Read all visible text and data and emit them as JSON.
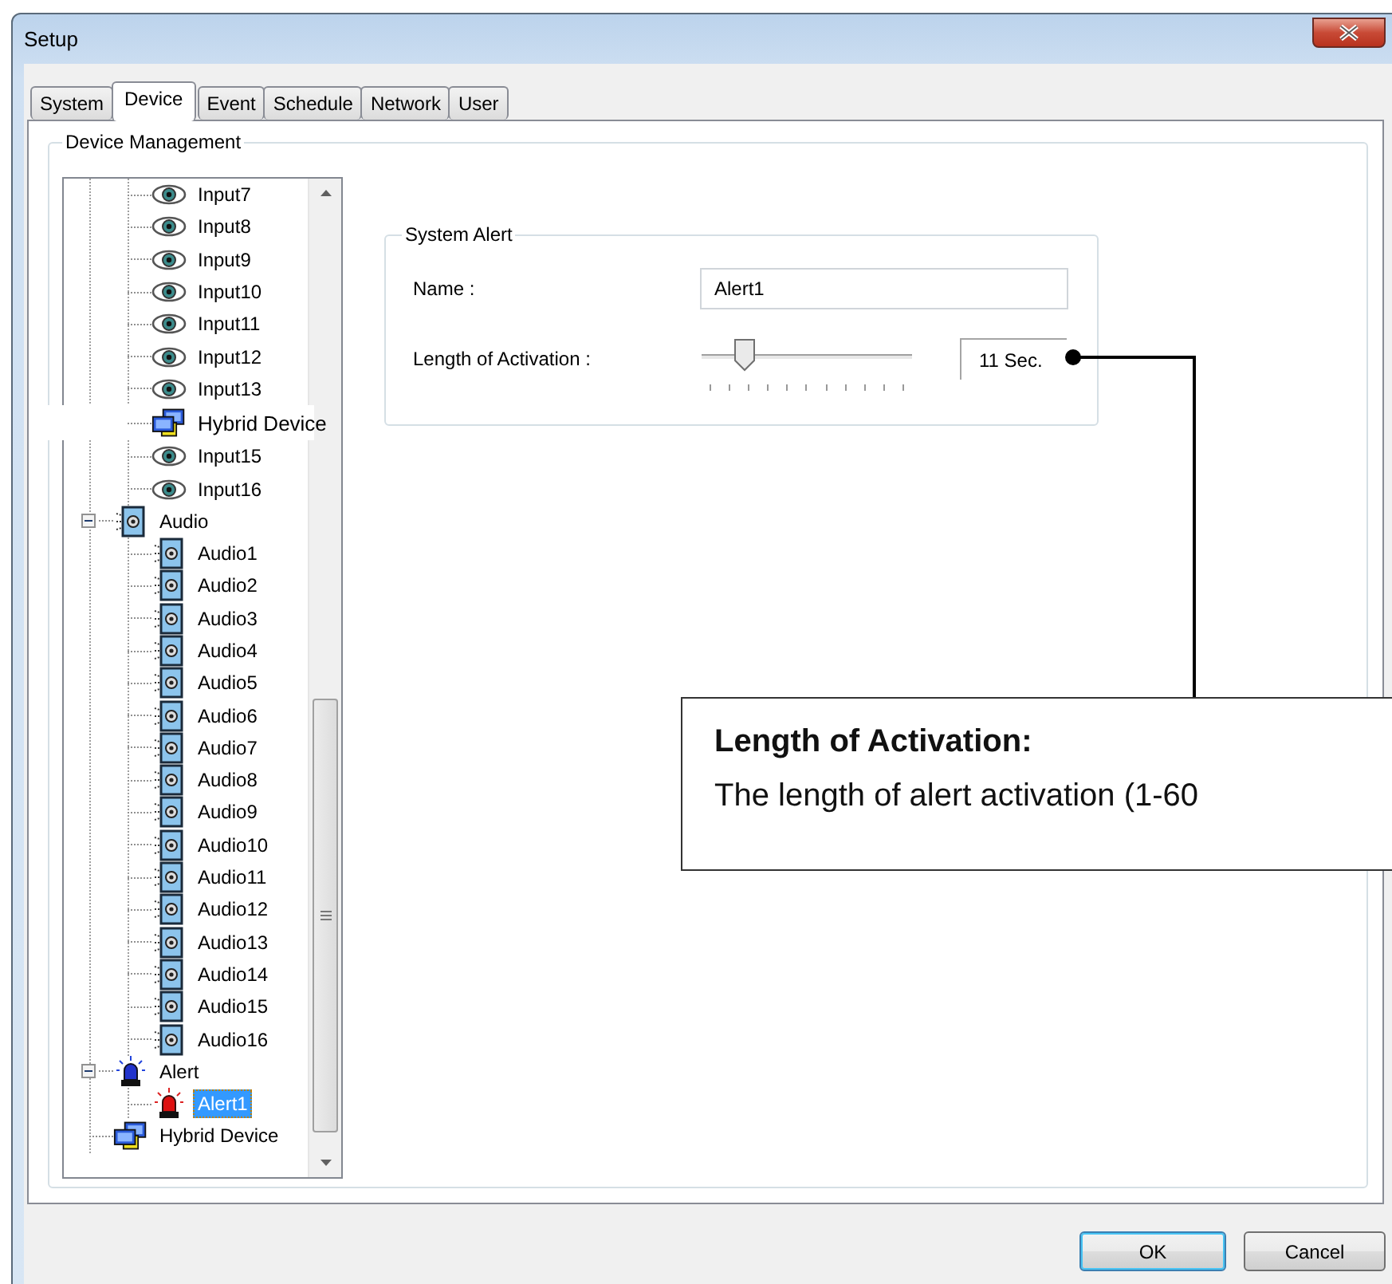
{
  "window": {
    "title": "Setup"
  },
  "tabs": [
    {
      "label": "System",
      "selected": false
    },
    {
      "label": "Device",
      "selected": true
    },
    {
      "label": "Event",
      "selected": false
    },
    {
      "label": "Schedule",
      "selected": false
    },
    {
      "label": "Network",
      "selected": false
    },
    {
      "label": "User",
      "selected": false
    }
  ],
  "group_title": "Device Management",
  "tree": [
    {
      "children": [
        {
          "label": "Input7",
          "kind": "camera",
          "selected": false
        },
        {
          "label": "Input8",
          "kind": "camera",
          "selected": false
        },
        {
          "label": "Input9",
          "kind": "camera",
          "selected": false
        },
        {
          "label": "Input10",
          "kind": "camera",
          "selected": false
        },
        {
          "label": "Input11",
          "kind": "camera",
          "selected": false
        },
        {
          "label": "Input12",
          "kind": "camera",
          "selected": false
        },
        {
          "label": "Input13",
          "kind": "camera",
          "selected": false
        },
        {
          "label": "Hybrid Device",
          "kind": "pasted_label",
          "selected": false
        },
        {
          "label": "Input15",
          "kind": "camera",
          "selected": false
        },
        {
          "label": "Input16",
          "kind": "camera",
          "selected": false
        }
      ]
    },
    {
      "label": "Audio",
      "kind": "audio_group",
      "expanded": true,
      "selected": false,
      "children": [
        {
          "label": "Audio1",
          "kind": "audio",
          "selected": false
        },
        {
          "label": "Audio2",
          "kind": "audio",
          "selected": false
        },
        {
          "label": "Audio3",
          "kind": "audio",
          "selected": false
        },
        {
          "label": "Audio4",
          "kind": "audio",
          "selected": false
        },
        {
          "label": "Audio5",
          "kind": "audio",
          "selected": false
        },
        {
          "label": "Audio6",
          "kind": "audio",
          "selected": false
        },
        {
          "label": "Audio7",
          "kind": "audio",
          "selected": false
        },
        {
          "label": "Audio8",
          "kind": "audio",
          "selected": false
        },
        {
          "label": "Audio9",
          "kind": "audio",
          "selected": false
        },
        {
          "label": "Audio10",
          "kind": "audio",
          "selected": false
        },
        {
          "label": "Audio11",
          "kind": "audio",
          "selected": false
        },
        {
          "label": "Audio12",
          "kind": "audio",
          "selected": false
        },
        {
          "label": "Audio13",
          "kind": "audio",
          "selected": false
        },
        {
          "label": "Audio14",
          "kind": "audio",
          "selected": false
        },
        {
          "label": "Audio15",
          "kind": "audio",
          "selected": false
        },
        {
          "label": "Audio16",
          "kind": "audio",
          "selected": false
        }
      ]
    },
    {
      "label": "Alert",
      "kind": "alert_group",
      "expanded": true,
      "selected": false,
      "children": [
        {
          "label": "Alert1",
          "kind": "alert",
          "selected": true
        }
      ]
    },
    {
      "label": "Hybrid Device",
      "kind": "hybrid",
      "selected": false
    }
  ],
  "system_alert": {
    "title": "System Alert",
    "name_label": "Name :",
    "name_value": "Alert1",
    "length_label": "Length of Activation :",
    "length": {
      "level": 0.17
    },
    "length_value": "11 Sec."
  },
  "buttons": [
    {
      "label": "OK",
      "default": true
    },
    {
      "label": "Cancel",
      "default": false
    }
  ],
  "callout": {
    "title": "Length of Activation:",
    "text": "The length of alert activation (1-60"
  }
}
